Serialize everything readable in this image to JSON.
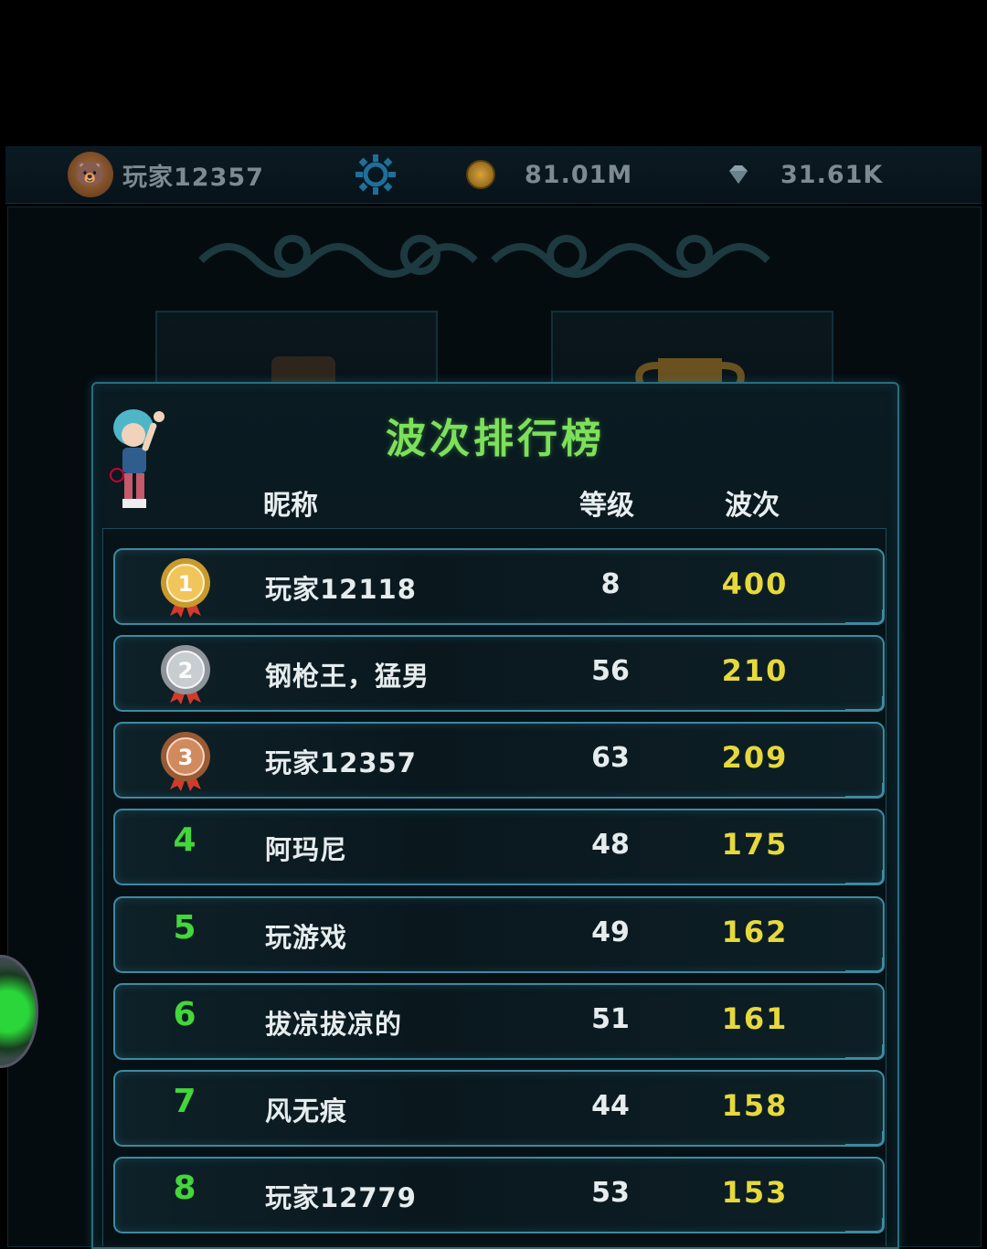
{
  "topbar": {
    "player_name": "玩家12357",
    "gold": "81.01M",
    "diamonds": "31.61K",
    "icons": [
      "bear-avatar-icon",
      "gear-icon",
      "coin-icon",
      "diamond-icon"
    ]
  },
  "leaderboard": {
    "title": "波次排行榜",
    "columns": {
      "nickname": "昵称",
      "level": "等级",
      "wave": "波次"
    },
    "rows": [
      {
        "rank": "1",
        "name": "玩家12118",
        "level": "8",
        "wave": "400"
      },
      {
        "rank": "2",
        "name": "钢枪王，猛男",
        "level": "56",
        "wave": "210"
      },
      {
        "rank": "3",
        "name": "玩家12357",
        "level": "63",
        "wave": "209"
      },
      {
        "rank": "4",
        "name": "阿玛尼",
        "level": "48",
        "wave": "175"
      },
      {
        "rank": "5",
        "name": "玩游戏",
        "level": "49",
        "wave": "162"
      },
      {
        "rank": "6",
        "name": "拔凉拔凉的",
        "level": "51",
        "wave": "161"
      },
      {
        "rank": "7",
        "name": "风无痕",
        "level": "44",
        "wave": "158"
      },
      {
        "rank": "8",
        "name": "玩家12779",
        "level": "53",
        "wave": "153"
      }
    ]
  },
  "colors": {
    "accent_green": "#44d63a",
    "wave_yellow": "#e6d93c",
    "frame_cyan": "#3d8aa0"
  }
}
